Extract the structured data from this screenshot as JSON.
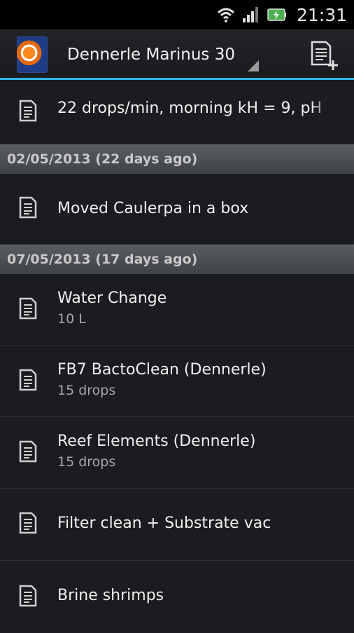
{
  "status_bar": {
    "time": "21:31"
  },
  "action_bar": {
    "aquarium_name": "Dennerle Marinus 30"
  },
  "list": {
    "top_row": {
      "title": "22 drops/min, morning kH = 9, pH"
    },
    "sections": [
      {
        "date": "02/05/2013 (22 days ago)",
        "entries": [
          {
            "title": "Moved Caulerpa in a box",
            "detail": ""
          }
        ]
      },
      {
        "date": "07/05/2013 (17 days ago)",
        "entries": [
          {
            "title": "Water Change",
            "detail": "10 L"
          },
          {
            "title": "FB7 BactoClean (Dennerle)",
            "detail": "15 drops"
          },
          {
            "title": "Reef Elements (Dennerle)",
            "detail": "15 drops"
          },
          {
            "title": "Filter clean + Substrate vac",
            "detail": ""
          },
          {
            "title": "Brine shrimps",
            "detail": ""
          }
        ]
      }
    ]
  }
}
